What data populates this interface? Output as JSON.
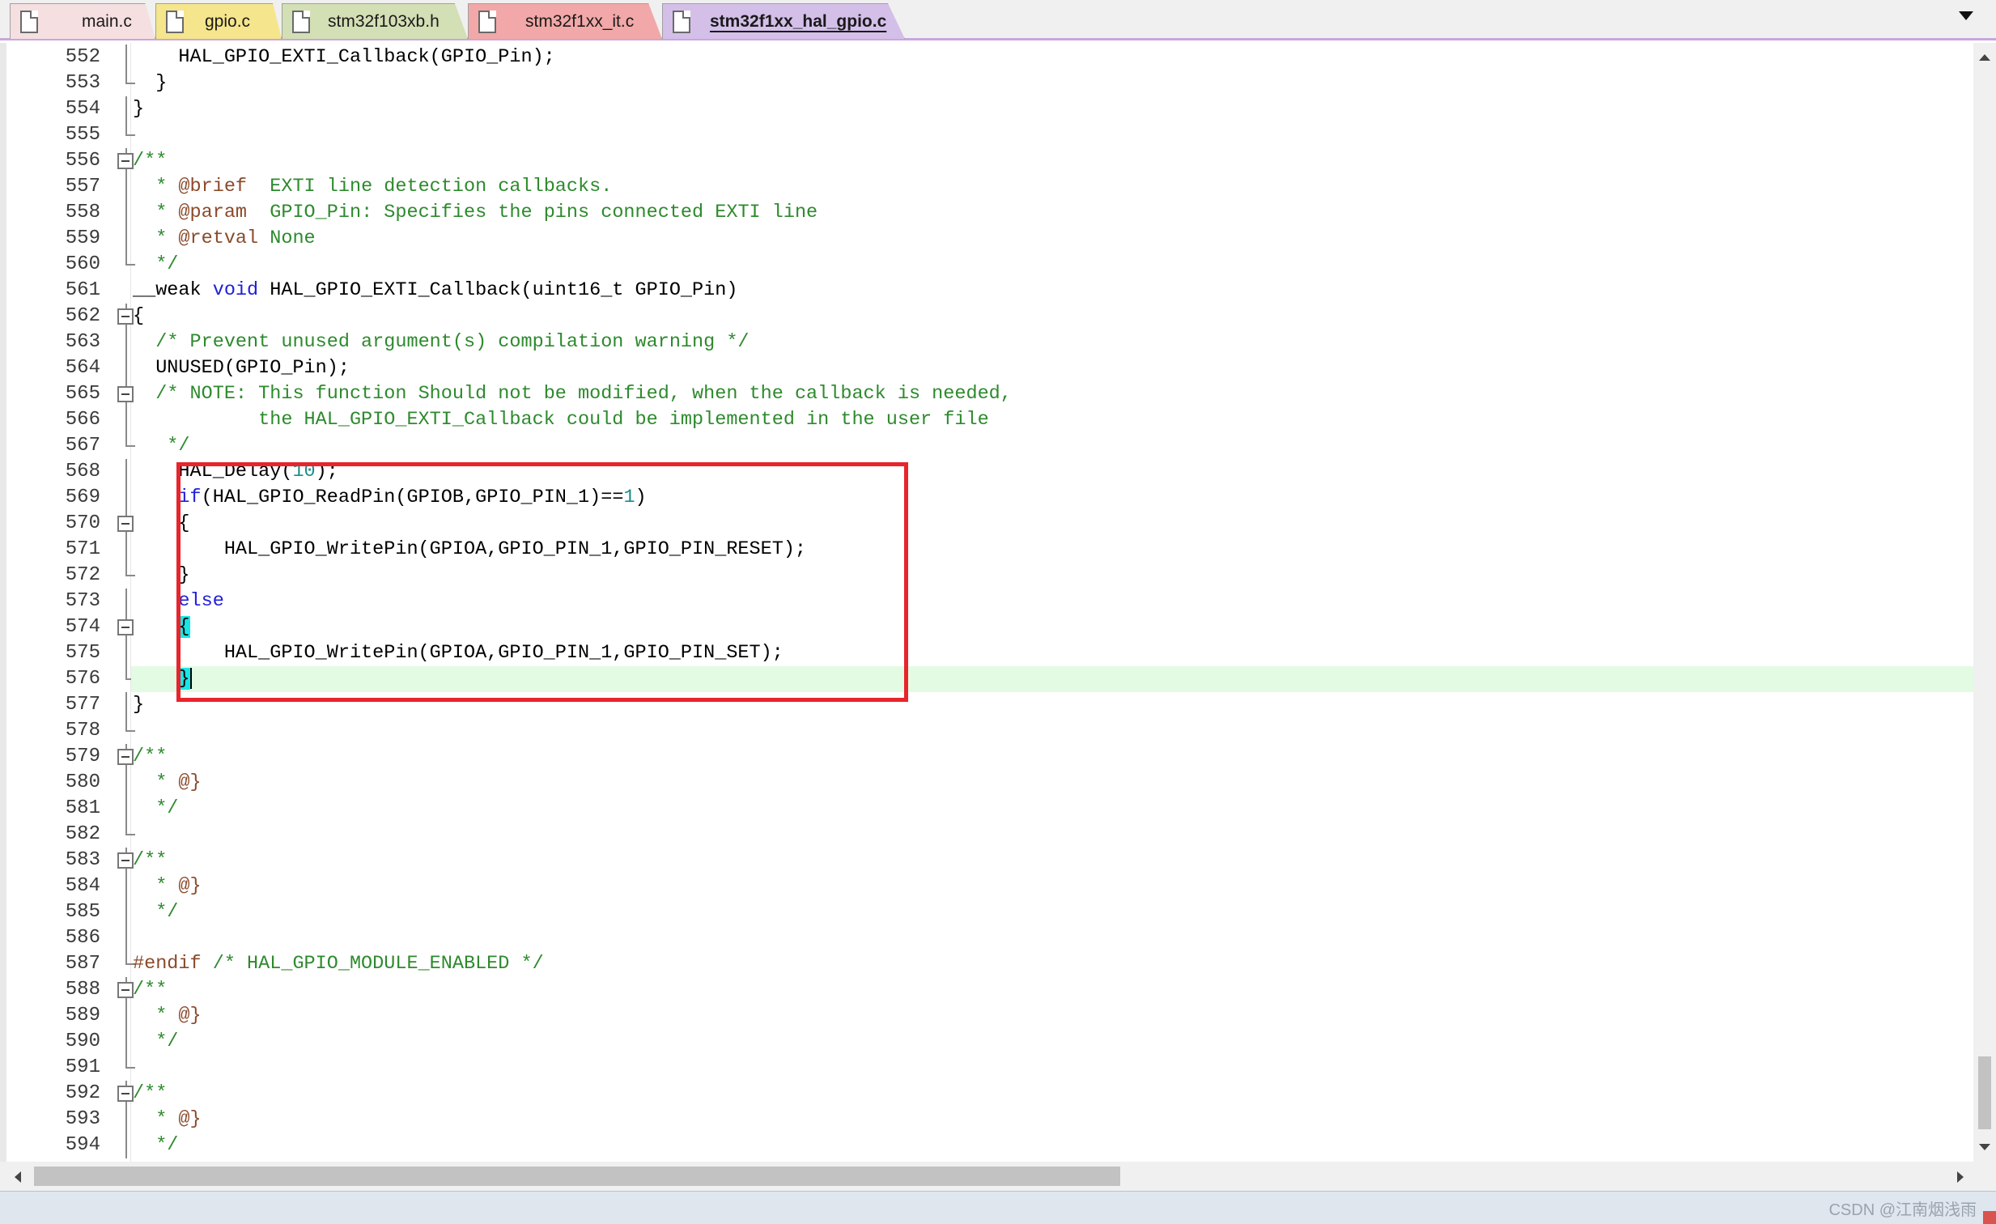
{
  "tabs": [
    {
      "label": "main.c",
      "color": "#f5dfe0",
      "active": false
    },
    {
      "label": "gpio.c",
      "color": "#f5e58c",
      "active": false
    },
    {
      "label": "stm32f103xb.h",
      "color": "#d3dfb4",
      "active": false
    },
    {
      "label": "stm32f1xx_it.c",
      "color": "#f2a8a8",
      "active": false
    },
    {
      "label": "stm32f1xx_hal_gpio.c",
      "color": "#d4bfe9",
      "active": true
    }
  ],
  "editor": {
    "lines": [
      {
        "n": "552",
        "fold": "guide",
        "segs": [
          {
            "t": "    HAL_GPIO_EXTI_Callback(GPIO_Pin);",
            "c": ""
          }
        ]
      },
      {
        "n": "553",
        "fold": "tick",
        "segs": [
          {
            "t": "  }",
            "c": ""
          }
        ]
      },
      {
        "n": "554",
        "fold": "guide",
        "segs": [
          {
            "t": "}",
            "c": ""
          }
        ]
      },
      {
        "n": "555",
        "fold": "tick",
        "segs": [
          {
            "t": "",
            "c": ""
          }
        ]
      },
      {
        "n": "556",
        "fold": "box",
        "segs": [
          {
            "t": "/**",
            "c": "comment"
          }
        ]
      },
      {
        "n": "557",
        "fold": "guide",
        "segs": [
          {
            "t": "  * ",
            "c": "comment"
          },
          {
            "t": "@brief",
            "c": "doctag"
          },
          {
            "t": "  EXTI line detection callbacks.",
            "c": "comment"
          }
        ]
      },
      {
        "n": "558",
        "fold": "guide",
        "segs": [
          {
            "t": "  * ",
            "c": "comment"
          },
          {
            "t": "@param",
            "c": "doctag"
          },
          {
            "t": "  GPIO_Pin: Specifies the pins connected EXTI line",
            "c": "comment"
          }
        ]
      },
      {
        "n": "559",
        "fold": "guide",
        "segs": [
          {
            "t": "  * ",
            "c": "comment"
          },
          {
            "t": "@retval",
            "c": "doctag"
          },
          {
            "t": " None",
            "c": "comment"
          }
        ]
      },
      {
        "n": "560",
        "fold": "tick",
        "segs": [
          {
            "t": "  */",
            "c": "comment"
          }
        ]
      },
      {
        "n": "561",
        "fold": "none",
        "segs": [
          {
            "t": "__weak ",
            "c": ""
          },
          {
            "t": "void",
            "c": "kw"
          },
          {
            "t": " HAL_GPIO_EXTI_Callback(uint16_t GPIO_Pin)",
            "c": ""
          }
        ]
      },
      {
        "n": "562",
        "fold": "box",
        "segs": [
          {
            "t": "{",
            "c": ""
          }
        ]
      },
      {
        "n": "563",
        "fold": "guide",
        "segs": [
          {
            "t": "  ",
            "c": ""
          },
          {
            "t": "/* Prevent unused argument(s) compilation warning */",
            "c": "comment"
          }
        ]
      },
      {
        "n": "564",
        "fold": "guide",
        "segs": [
          {
            "t": "  UNUSED(GPIO_Pin);",
            "c": ""
          }
        ]
      },
      {
        "n": "565",
        "fold": "box",
        "segs": [
          {
            "t": "  ",
            "c": ""
          },
          {
            "t": "/* NOTE: This function Should not be modified, when the callback is needed,",
            "c": "comment"
          }
        ]
      },
      {
        "n": "566",
        "fold": "guide",
        "segs": [
          {
            "t": "           the HAL_GPIO_EXTI_Callback could be implemented in the user file",
            "c": "comment"
          }
        ]
      },
      {
        "n": "567",
        "fold": "tick",
        "segs": [
          {
            "t": "   */",
            "c": "comment"
          }
        ]
      },
      {
        "n": "568",
        "fold": "guide",
        "segs": [
          {
            "t": "    HAL_Delay(",
            "c": ""
          },
          {
            "t": "10",
            "c": "num"
          },
          {
            "t": ");",
            "c": ""
          }
        ]
      },
      {
        "n": "569",
        "fold": "guide",
        "segs": [
          {
            "t": "    ",
            "c": ""
          },
          {
            "t": "if",
            "c": "kw"
          },
          {
            "t": "(HAL_GPIO_ReadPin(GPIOB,GPIO_PIN_1)==",
            "c": ""
          },
          {
            "t": "1",
            "c": "num"
          },
          {
            "t": ")",
            "c": ""
          }
        ]
      },
      {
        "n": "570",
        "fold": "box",
        "segs": [
          {
            "t": "    {",
            "c": ""
          }
        ]
      },
      {
        "n": "571",
        "fold": "guide",
        "segs": [
          {
            "t": "        HAL_GPIO_WritePin(GPIOA,GPIO_PIN_1,GPIO_PIN_RESET);",
            "c": ""
          }
        ]
      },
      {
        "n": "572",
        "fold": "tick",
        "segs": [
          {
            "t": "    }",
            "c": ""
          }
        ]
      },
      {
        "n": "573",
        "fold": "guide",
        "segs": [
          {
            "t": "    ",
            "c": ""
          },
          {
            "t": "else",
            "c": "kw"
          }
        ]
      },
      {
        "n": "574",
        "fold": "box",
        "segs": [
          {
            "t": "    ",
            "c": ""
          },
          {
            "t": "{",
            "c": "brace-hl"
          }
        ]
      },
      {
        "n": "575",
        "fold": "guide",
        "segs": [
          {
            "t": "        HAL_GPIO_WritePin(GPIOA,GPIO_PIN_1,GPIO_PIN_SET);",
            "c": ""
          }
        ]
      },
      {
        "n": "576",
        "fold": "tick",
        "segs": [
          {
            "t": "    ",
            "c": ""
          },
          {
            "t": "}",
            "c": "brace-hl"
          },
          {
            "t": "",
            "c": "caret"
          }
        ],
        "current": true
      },
      {
        "n": "577",
        "fold": "guide",
        "segs": [
          {
            "t": "}",
            "c": ""
          }
        ]
      },
      {
        "n": "578",
        "fold": "tick",
        "segs": [
          {
            "t": "",
            "c": ""
          }
        ]
      },
      {
        "n": "579",
        "fold": "box",
        "segs": [
          {
            "t": "/**",
            "c": "comment"
          }
        ]
      },
      {
        "n": "580",
        "fold": "guide",
        "segs": [
          {
            "t": "  * ",
            "c": "comment"
          },
          {
            "t": "@}",
            "c": "doctag"
          }
        ]
      },
      {
        "n": "581",
        "fold": "guide",
        "segs": [
          {
            "t": "  */",
            "c": "comment"
          }
        ]
      },
      {
        "n": "582",
        "fold": "tick",
        "segs": [
          {
            "t": "",
            "c": ""
          }
        ]
      },
      {
        "n": "583",
        "fold": "box",
        "segs": [
          {
            "t": "/**",
            "c": "comment"
          }
        ]
      },
      {
        "n": "584",
        "fold": "guide",
        "segs": [
          {
            "t": "  * ",
            "c": "comment"
          },
          {
            "t": "@}",
            "c": "doctag"
          }
        ]
      },
      {
        "n": "585",
        "fold": "guide",
        "segs": [
          {
            "t": "  */",
            "c": "comment"
          }
        ]
      },
      {
        "n": "586",
        "fold": "guide",
        "segs": [
          {
            "t": "",
            "c": ""
          }
        ]
      },
      {
        "n": "587",
        "fold": "tick",
        "segs": [
          {
            "t": "#endif",
            "c": "pre"
          },
          {
            "t": " /* HAL_GPIO_MODULE_ENABLED */",
            "c": "comment"
          }
        ]
      },
      {
        "n": "588",
        "fold": "box",
        "segs": [
          {
            "t": "/**",
            "c": "comment"
          }
        ]
      },
      {
        "n": "589",
        "fold": "guide",
        "segs": [
          {
            "t": "  * ",
            "c": "comment"
          },
          {
            "t": "@}",
            "c": "doctag"
          }
        ]
      },
      {
        "n": "590",
        "fold": "guide",
        "segs": [
          {
            "t": "  */",
            "c": "comment"
          }
        ]
      },
      {
        "n": "591",
        "fold": "tick",
        "segs": [
          {
            "t": "",
            "c": ""
          }
        ]
      },
      {
        "n": "592",
        "fold": "box",
        "segs": [
          {
            "t": "/**",
            "c": "comment"
          }
        ]
      },
      {
        "n": "593",
        "fold": "guide",
        "segs": [
          {
            "t": "  * ",
            "c": "comment"
          },
          {
            "t": "@}",
            "c": "doctag"
          }
        ]
      },
      {
        "n": "594",
        "fold": "guide",
        "segs": [
          {
            "t": "  */",
            "c": "comment"
          }
        ]
      }
    ]
  },
  "annotation": {
    "color": "#e8242c"
  },
  "watermark": "CSDN @江南烟浅雨"
}
